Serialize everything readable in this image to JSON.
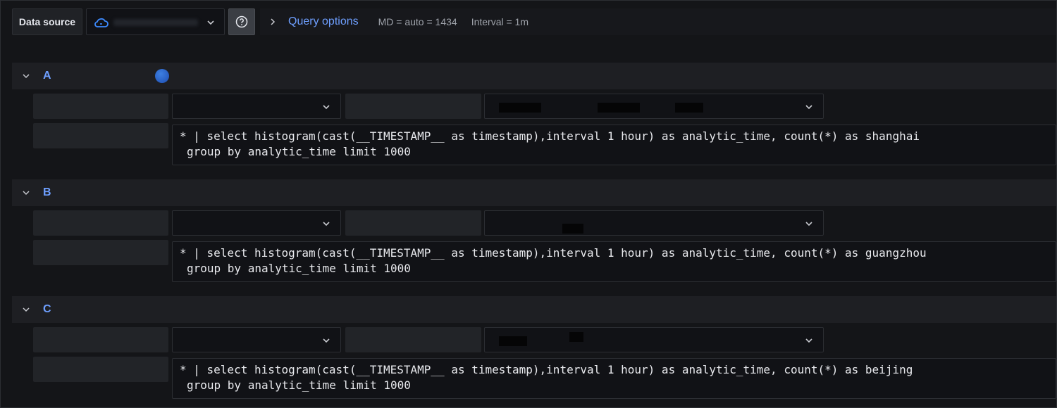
{
  "toolbar": {
    "data_source_label": "Data source",
    "query_options_label": "Query options",
    "md_text": "MD = auto = 1434",
    "interval_text": "Interval = 1m"
  },
  "queries": [
    {
      "ref_id": "A",
      "query_line1": "* | select histogram(cast(__TIMESTAMP__ as timestamp),interval 1 hour) as analytic_time, count(*) as shanghai",
      "query_line2": "group by analytic_time limit 1000"
    },
    {
      "ref_id": "B",
      "query_line1": "* | select histogram(cast(__TIMESTAMP__ as timestamp),interval 1 hour) as analytic_time, count(*) as guangzhou",
      "query_line2": "group by analytic_time limit 1000"
    },
    {
      "ref_id": "C",
      "query_line1": "* | select histogram(cast(__TIMESTAMP__ as timestamp),interval 1 hour) as analytic_time, count(*) as beijing",
      "query_line2": "group by analytic_time limit 1000"
    }
  ],
  "icons": {
    "data_source": "cloud-icon",
    "help": "question-circle-icon",
    "expand": "chevron-right-icon",
    "collapse": "chevron-down-icon"
  },
  "colors": {
    "accent": "#6e9fff",
    "background": "#141518"
  }
}
